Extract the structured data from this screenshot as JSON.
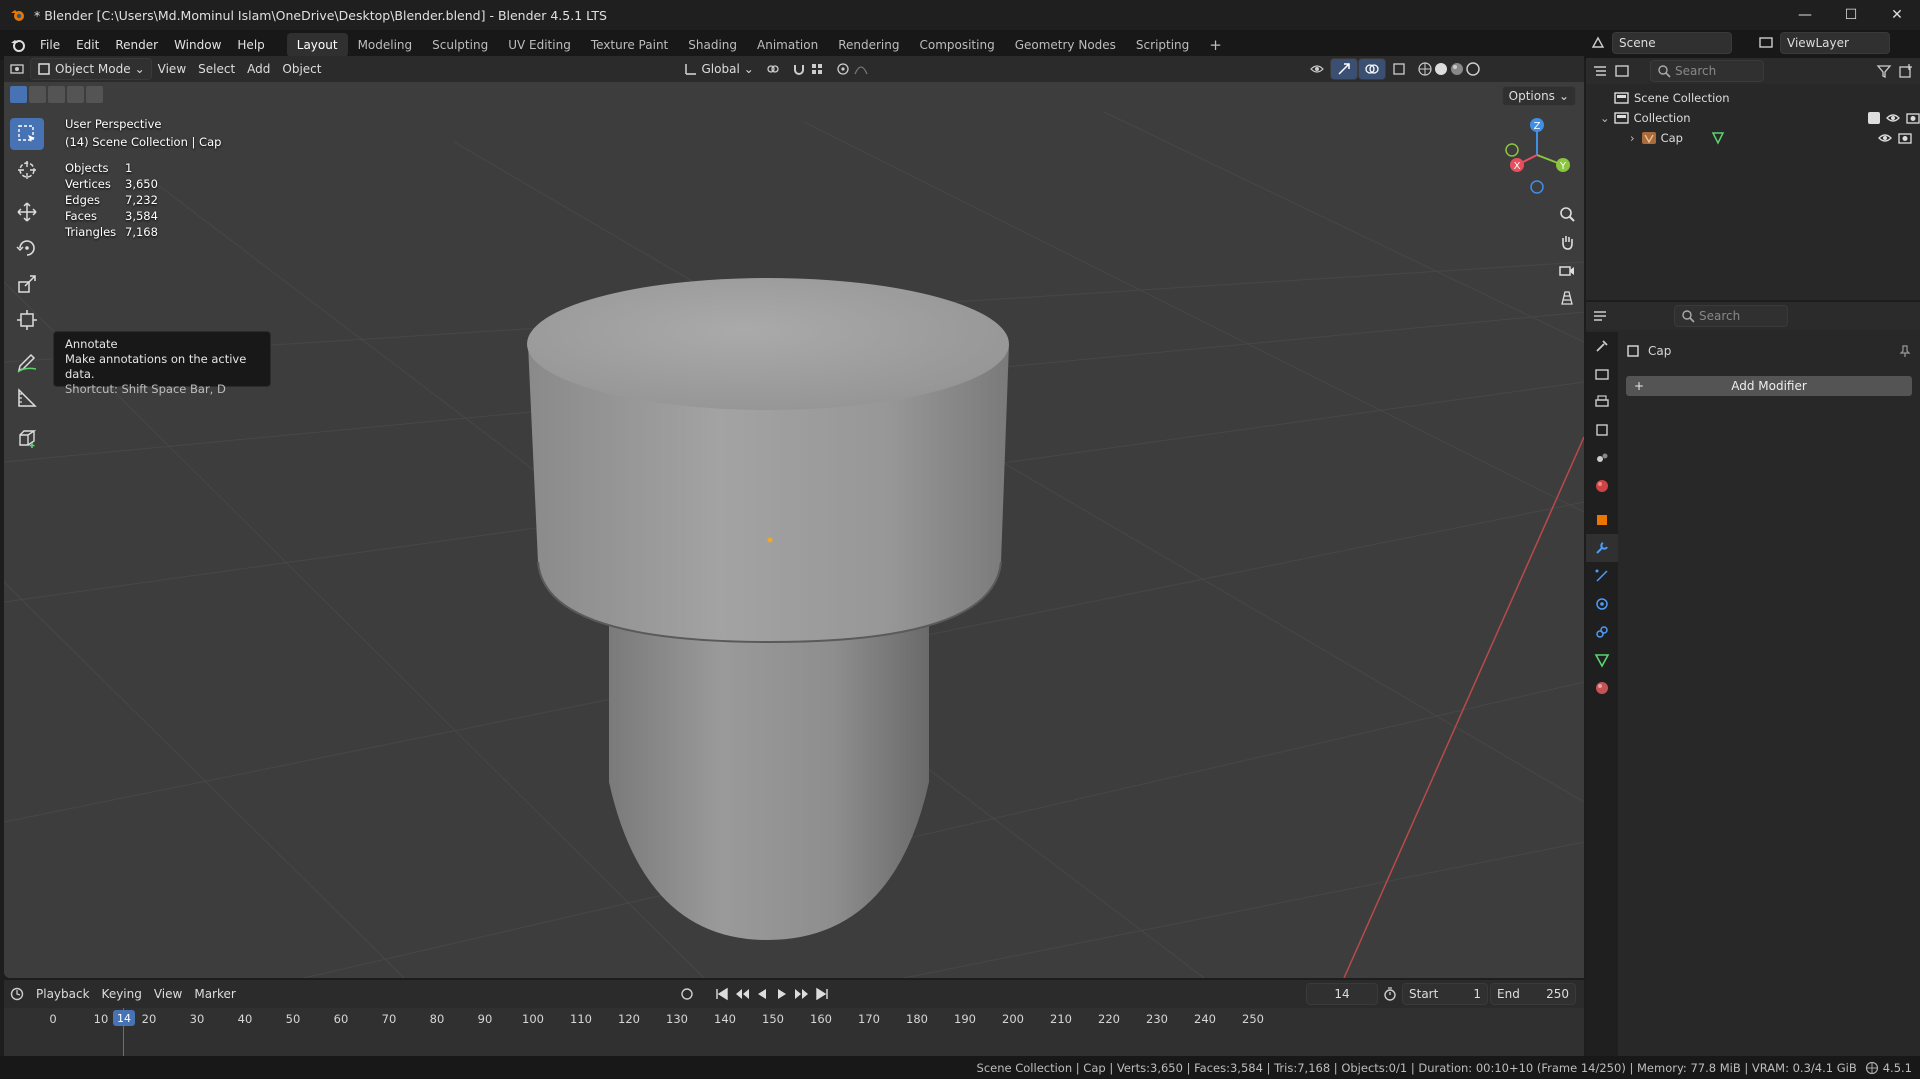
{
  "window": {
    "title": "* Blender [C:\\Users\\Md.Mominul Islam\\OneDrive\\Desktop\\Blender.blend] - Blender 4.5.1 LTS",
    "controls": [
      "—",
      "☐",
      "✕"
    ]
  },
  "menu": {
    "items": [
      "File",
      "Edit",
      "Render",
      "Window",
      "Help"
    ]
  },
  "workspaces": {
    "tabs": [
      "Layout",
      "Modeling",
      "Sculpting",
      "UV Editing",
      "Texture Paint",
      "Shading",
      "Animation",
      "Rendering",
      "Compositing",
      "Geometry Nodes",
      "Scripting"
    ],
    "active": "Layout",
    "add_icon": "+"
  },
  "top_right": {
    "scene": "Scene",
    "view_layer": "ViewLayer"
  },
  "viewport_header": {
    "mode": "Object Mode",
    "menus": [
      "View",
      "Select",
      "Add",
      "Object"
    ],
    "orientation": "Global",
    "options": "Options"
  },
  "viewport_info": {
    "view_name": "User Perspective",
    "collection_line": "(14) Scene Collection | Cap",
    "stats": [
      {
        "label": "Objects",
        "value": "1"
      },
      {
        "label": "Vertices",
        "value": "3,650"
      },
      {
        "label": "Edges",
        "value": "7,232"
      },
      {
        "label": "Faces",
        "value": "3,584"
      },
      {
        "label": "Triangles",
        "value": "7,168"
      }
    ]
  },
  "tooltip": {
    "title": "Annotate",
    "description": "Make annotations on the active data.",
    "shortcut": "Shortcut: Shift Space Bar, D"
  },
  "gizmo": {
    "x": "X",
    "y": "Y",
    "z": "Z"
  },
  "outliner": {
    "search_placeholder": "Search",
    "scene_collection": "Scene Collection",
    "collection": "Collection",
    "object": "Cap"
  },
  "properties": {
    "search_placeholder": "Search",
    "object_name": "Cap",
    "add_modifier": "Add Modifier"
  },
  "timeline": {
    "menus": [
      "Playback",
      "Keying",
      "View",
      "Marker"
    ],
    "current_frame": "14",
    "start_label": "Start",
    "start": "1",
    "end_label": "End",
    "end": "250",
    "ticks": [
      "0",
      "10",
      "20",
      "30",
      "40",
      "50",
      "60",
      "70",
      "80",
      "90",
      "100",
      "110",
      "120",
      "130",
      "140",
      "150",
      "160",
      "170",
      "180",
      "190",
      "200",
      "210",
      "220",
      "230",
      "240",
      "250"
    ]
  },
  "statusbar": {
    "text": "Scene Collection | Cap | Verts:3,650 | Faces:3,584 | Tris:7,168 | Objects:0/1 | Duration: 00:10+10 (Frame 14/250) | Memory: 77.8 MiB | VRAM: 0.3/4.1 GiB",
    "version": "4.5.1"
  },
  "colors": {
    "accent": "#4772b3",
    "x_axis": "#e84f5c",
    "y_axis": "#8bc53f",
    "z_axis": "#3f8fe6",
    "object_origin": "#f5a623"
  }
}
